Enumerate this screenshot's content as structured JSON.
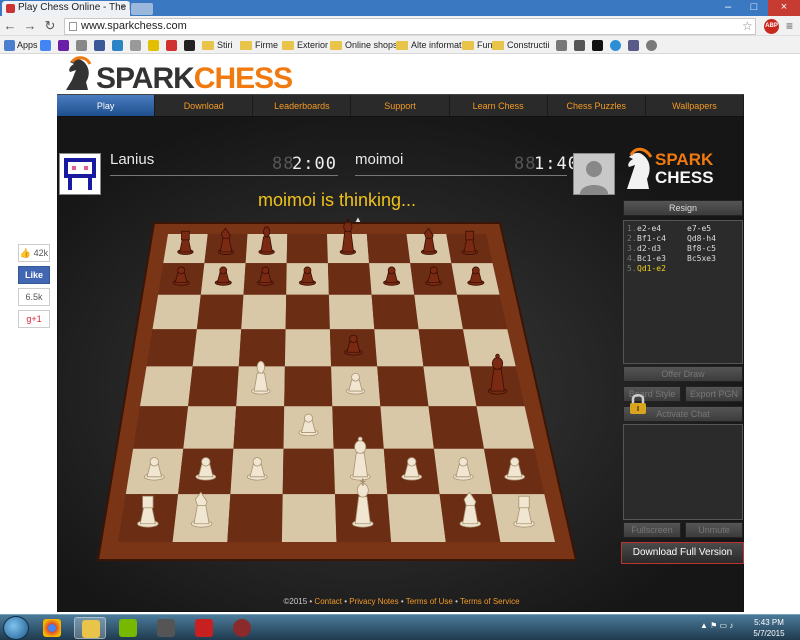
{
  "browser": {
    "tab_title": "Play Chess Online - The P",
    "url": "www.sparkchess.com",
    "bookmarks": [
      {
        "label": "Apps",
        "kind": "apps"
      },
      {
        "label": "Stiri",
        "kind": "folder"
      },
      {
        "label": "Firme",
        "kind": "folder"
      },
      {
        "label": "Exterior",
        "kind": "folder"
      },
      {
        "label": "Online shops",
        "kind": "folder"
      },
      {
        "label": "Alte informatii",
        "kind": "folder"
      },
      {
        "label": "Fun",
        "kind": "folder"
      },
      {
        "label": "Constructii",
        "kind": "folder"
      }
    ]
  },
  "site": {
    "logo_part1": "SPARK",
    "logo_part2": "CHESS",
    "nav": [
      {
        "label": "Play",
        "active": true
      },
      {
        "label": "Download",
        "active": false
      },
      {
        "label": "Leaderboards",
        "active": false
      },
      {
        "label": "Support",
        "active": false
      },
      {
        "label": "Learn Chess",
        "active": false
      },
      {
        "label": "Chess Puzzles",
        "active": false
      },
      {
        "label": "Wallpapers",
        "active": false
      }
    ]
  },
  "game": {
    "player1": {
      "name": "Lanius",
      "clock": "2:00"
    },
    "player2": {
      "name": "moimoi",
      "clock": "1:40"
    },
    "status": "moimoi is thinking...",
    "resign": "Resign",
    "moves": [
      {
        "num": "1.",
        "white": "e2-e4",
        "black": "e7-e5"
      },
      {
        "num": "2.",
        "white": "Bf1-c4",
        "black": "Qd8-h4"
      },
      {
        "num": "3.",
        "white": "d2-d3",
        "black": "Bf8-c5"
      },
      {
        "num": "4.",
        "white": "Bc1-e3",
        "black": "Bc5xe3"
      },
      {
        "num": "5.",
        "white": "Qd1-e2",
        "black": ""
      }
    ],
    "offer_draw": "Offer Draw",
    "board_style": "Board Style",
    "export_pgn": "Export PGN",
    "activate_chat": "Activate Chat",
    "fullscreen": "Fullscreen",
    "unmute": "Unmute",
    "download_full": "Download Full Version",
    "sidebar_logo1": "SPARK",
    "sidebar_logo2": "CHESS",
    "pieces": [
      {
        "sq": "a8",
        "p": "r",
        "c": "b"
      },
      {
        "sq": "b8",
        "p": "n",
        "c": "b"
      },
      {
        "sq": "c8",
        "p": "b",
        "c": "b"
      },
      {
        "sq": "e8",
        "p": "k",
        "c": "b"
      },
      {
        "sq": "g8",
        "p": "n",
        "c": "b"
      },
      {
        "sq": "h8",
        "p": "r",
        "c": "b"
      },
      {
        "sq": "a7",
        "p": "p",
        "c": "b"
      },
      {
        "sq": "b7",
        "p": "p",
        "c": "b"
      },
      {
        "sq": "c7",
        "p": "p",
        "c": "b"
      },
      {
        "sq": "d7",
        "p": "p",
        "c": "b"
      },
      {
        "sq": "f7",
        "p": "p",
        "c": "b"
      },
      {
        "sq": "g7",
        "p": "p",
        "c": "b"
      },
      {
        "sq": "h7",
        "p": "p",
        "c": "b"
      },
      {
        "sq": "e5",
        "p": "p",
        "c": "b"
      },
      {
        "sq": "h4",
        "p": "q",
        "c": "b"
      },
      {
        "sq": "c4",
        "p": "b",
        "c": "w"
      },
      {
        "sq": "e4",
        "p": "p",
        "c": "w"
      },
      {
        "sq": "d3",
        "p": "p",
        "c": "w"
      },
      {
        "sq": "a2",
        "p": "p",
        "c": "w"
      },
      {
        "sq": "b2",
        "p": "p",
        "c": "w"
      },
      {
        "sq": "c2",
        "p": "p",
        "c": "w"
      },
      {
        "sq": "e2",
        "p": "q",
        "c": "w"
      },
      {
        "sq": "f2",
        "p": "p",
        "c": "w"
      },
      {
        "sq": "g2",
        "p": "p",
        "c": "w"
      },
      {
        "sq": "h2",
        "p": "p",
        "c": "w"
      },
      {
        "sq": "a1",
        "p": "r",
        "c": "w"
      },
      {
        "sq": "b1",
        "p": "n",
        "c": "w"
      },
      {
        "sq": "e1",
        "p": "k",
        "c": "w"
      },
      {
        "sq": "g1",
        "p": "n",
        "c": "w"
      },
      {
        "sq": "h1",
        "p": "r",
        "c": "w"
      }
    ]
  },
  "social": {
    "likes": "42k",
    "like_label": "Like",
    "shares": "6.5k",
    "gplus": "g+1"
  },
  "footer": {
    "copyright": "©2015",
    "links": [
      "Contact",
      "Privacy Notes",
      "Terms of Use",
      "Terms of Service"
    ]
  },
  "taskbar": {
    "time": "5:43 PM",
    "date": "5/7/2015"
  },
  "colors": {
    "accent": "#f39a25",
    "status_yellow": "#f0c21a",
    "light_square": "#d9c8a8",
    "dark_square": "#6b2d14"
  }
}
